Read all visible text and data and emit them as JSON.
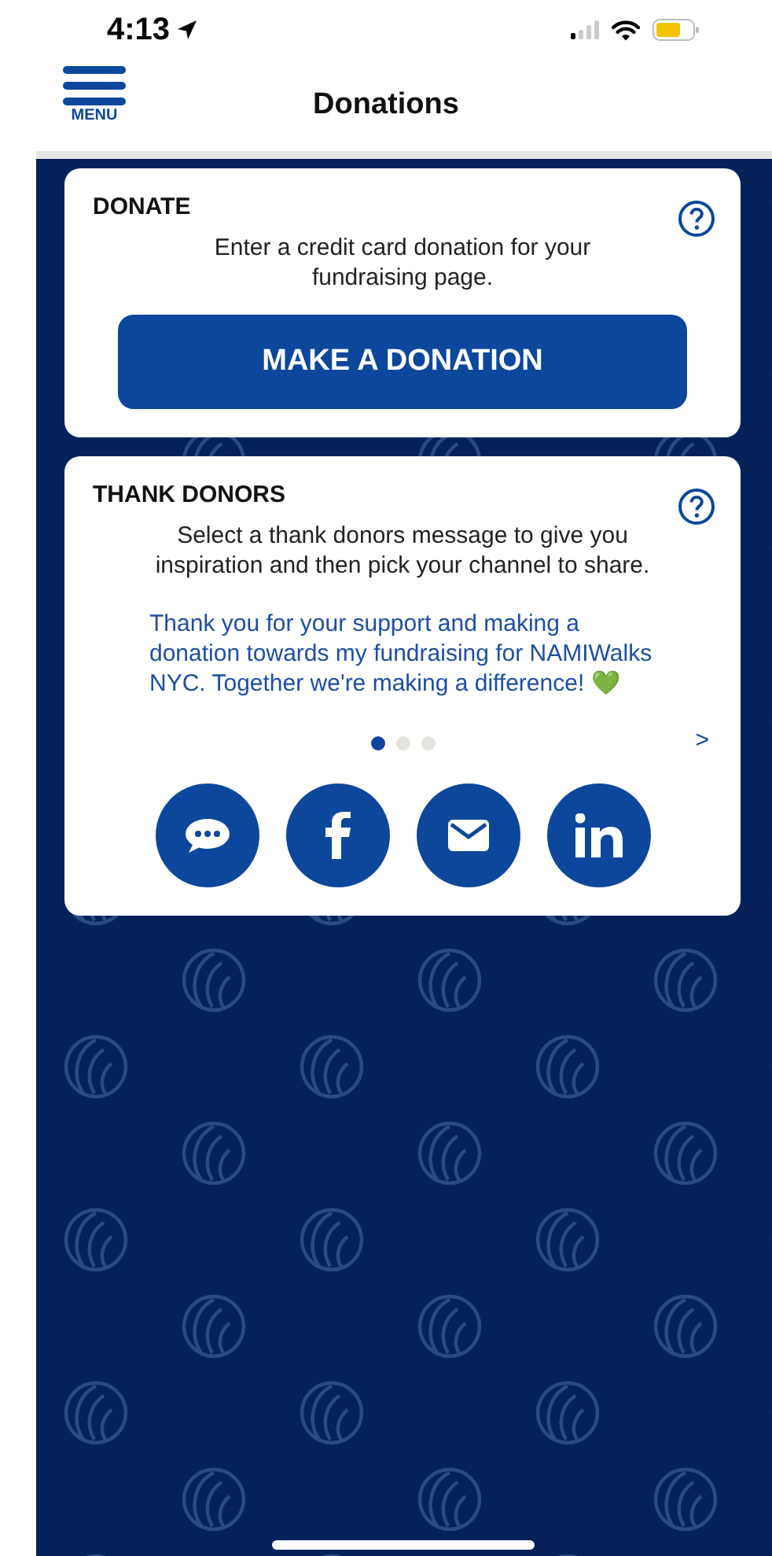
{
  "status_bar": {
    "time": "4:13"
  },
  "header": {
    "menu_label": "MENU",
    "title": "Donations"
  },
  "donate_card": {
    "title": "DONATE",
    "description": "Enter a credit card donation for your fundraising page.",
    "button": "MAKE A DONATION"
  },
  "thank_card": {
    "title": "THANK DONORS",
    "description": "Select a thank donors message to give you inspiration and then pick your channel to share.",
    "message": "Thank you for your support and making a donation towards my fundraising for NAMIWalks NYC. Together we're making a difference! 💚",
    "pages": [
      {
        "selected": true
      },
      {
        "selected": false
      },
      {
        "selected": false
      }
    ],
    "next": ">",
    "share": [
      {
        "kind": "message"
      },
      {
        "kind": "facebook"
      },
      {
        "kind": "email"
      },
      {
        "kind": "linkedin"
      }
    ]
  }
}
